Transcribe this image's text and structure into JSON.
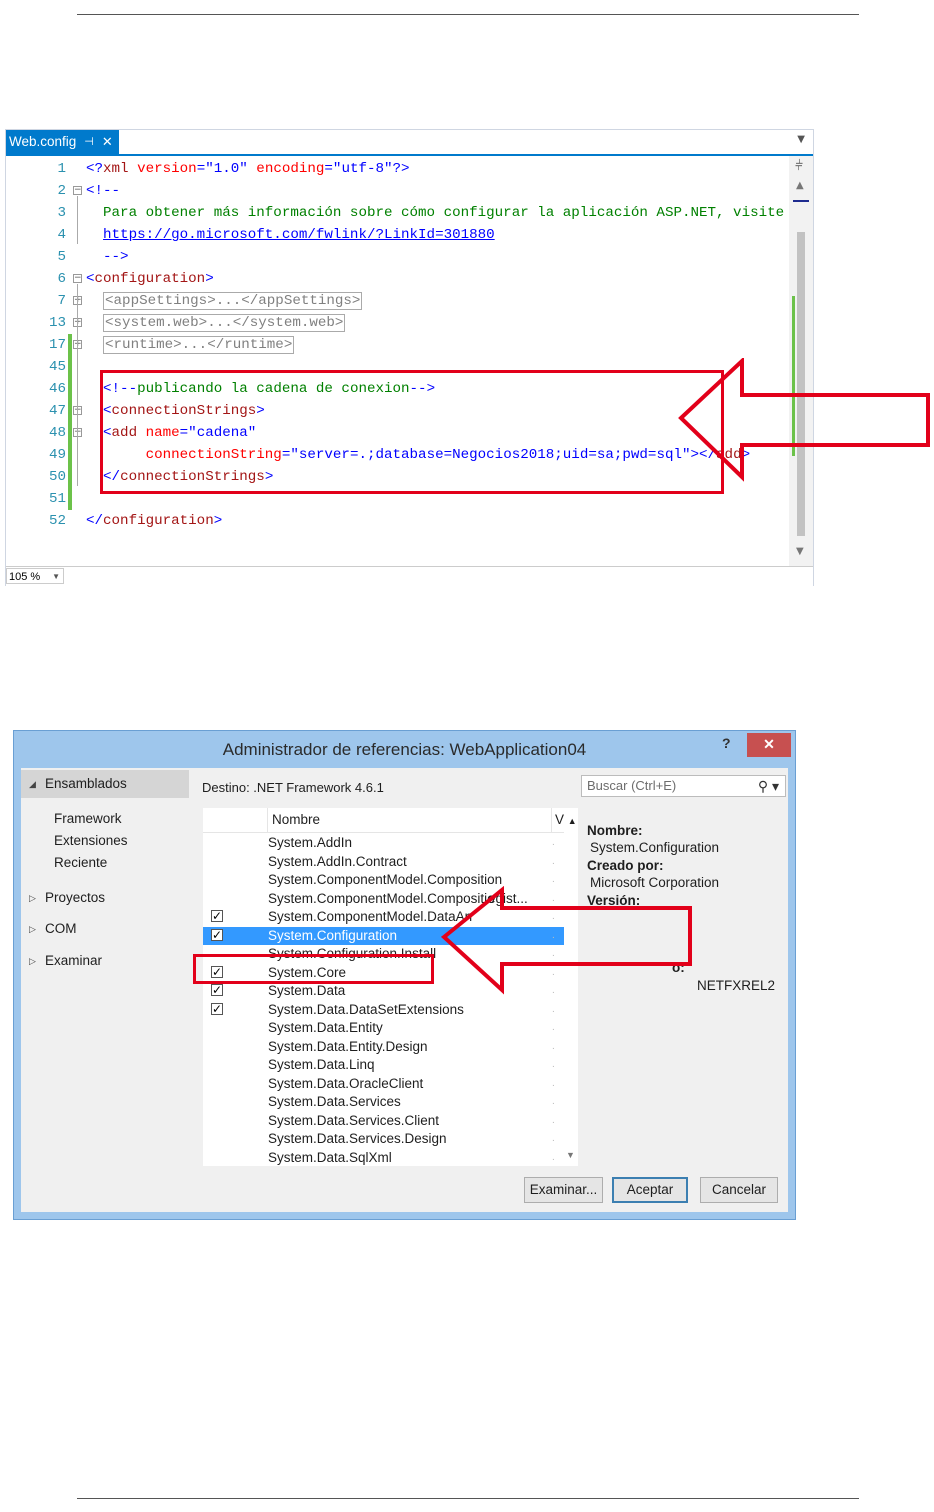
{
  "editor": {
    "tab_label": "Web.config",
    "tab_pin": "⊣",
    "tab_close": "✕",
    "zoom": "105 %",
    "lines": [
      {
        "num": "1",
        "parts": [
          [
            "blue",
            "<?"
          ],
          [
            "mar",
            "xml"
          ],
          [
            "red",
            " version"
          ],
          [
            "blue",
            "=\""
          ],
          [
            "blue",
            "1.0"
          ],
          [
            "blue",
            "\""
          ],
          [
            "red",
            " encoding"
          ],
          [
            "blue",
            "=\""
          ],
          [
            "blue",
            "utf-8"
          ],
          [
            "blue",
            "\"?>"
          ]
        ]
      },
      {
        "num": "2",
        "parts": [
          [
            "blue",
            "<!--"
          ]
        ]
      },
      {
        "num": "3",
        "parts": [
          [
            "green",
            "  Para obtener más información sobre cómo configurar la aplicación ASP.NET, visite"
          ]
        ]
      },
      {
        "num": "4",
        "parts": [
          [
            "green",
            "  "
          ],
          [
            "link",
            "https://go.microsoft.com/fwlink/?LinkId=301880"
          ]
        ]
      },
      {
        "num": "5",
        "parts": [
          [
            "blue",
            "  -->"
          ]
        ]
      },
      {
        "num": "6",
        "parts": [
          [
            "blue",
            "<"
          ],
          [
            "mar",
            "configuration"
          ],
          [
            "blue",
            ">"
          ]
        ]
      },
      {
        "num": "7",
        "parts": [
          [
            "plain",
            "  "
          ],
          [
            "collapsed",
            "<appSettings>...</appSettings>"
          ]
        ]
      },
      {
        "num": "13",
        "parts": [
          [
            "plain",
            "  "
          ],
          [
            "collapsed",
            "<system.web>...</system.web>"
          ]
        ]
      },
      {
        "num": "17",
        "parts": [
          [
            "plain",
            "  "
          ],
          [
            "collapsed",
            "<runtime>...</runtime>"
          ]
        ]
      },
      {
        "num": "45",
        "parts": []
      },
      {
        "num": "46",
        "parts": [
          [
            "blue",
            "  <!--"
          ],
          [
            "green",
            "publicando la cadena de conexion"
          ],
          [
            "blue",
            "-->"
          ]
        ]
      },
      {
        "num": "47",
        "parts": [
          [
            "blue",
            "  <"
          ],
          [
            "mar",
            "connectionStrings"
          ],
          [
            "blue",
            ">"
          ]
        ]
      },
      {
        "num": "48",
        "parts": [
          [
            "blue",
            "  <"
          ],
          [
            "mar",
            "add"
          ],
          [
            "red",
            " name"
          ],
          [
            "blue",
            "=\""
          ],
          [
            "blue",
            "cadena"
          ],
          [
            "blue",
            "\""
          ]
        ]
      },
      {
        "num": "49",
        "parts": [
          [
            "red",
            "       connectionString"
          ],
          [
            "blue",
            "=\""
          ],
          [
            "blue",
            "server=.;database=Negocios2018;uid=sa;pwd=sql"
          ],
          [
            "blue",
            "\"></"
          ],
          [
            "mar",
            "add"
          ],
          [
            "blue",
            ">"
          ]
        ]
      },
      {
        "num": "50",
        "parts": [
          [
            "blue",
            "  </"
          ],
          [
            "mar",
            "connectionStrings"
          ],
          [
            "blue",
            ">"
          ]
        ]
      },
      {
        "num": "51",
        "parts": []
      },
      {
        "num": "52",
        "parts": [
          [
            "blue",
            "</"
          ],
          [
            "mar",
            "configuration"
          ],
          [
            "blue",
            ">"
          ]
        ]
      }
    ]
  },
  "dialog": {
    "title": "Administrador de referencias: WebApplication04",
    "help": "?",
    "close": "✕",
    "nav": {
      "ensamblados": "Ensamblados",
      "framework": "Framework",
      "extensiones": "Extensiones",
      "reciente": "Reciente",
      "proyectos": "Proyectos",
      "com": "COM",
      "examinar": "Examinar"
    },
    "destino": "Destino: .NET Framework 4.6.1",
    "search_placeholder": "Buscar (Ctrl+E)",
    "columns": {
      "nombre": "Nombre",
      "version": "V"
    },
    "assemblies": [
      {
        "name": "System.AddIn",
        "checked": false
      },
      {
        "name": "System.AddIn.Contract",
        "checked": false
      },
      {
        "name": "System.ComponentModel.Composition",
        "checked": false
      },
      {
        "name": "System.ComponentModel.Compositio",
        "checked": false
      },
      {
        "name": "System.ComponentModel.DataAn",
        "checked": true
      },
      {
        "name": "System.Configuration",
        "checked": true,
        "selected": true
      },
      {
        "name": "System.Configuration.Install",
        "checked": false
      },
      {
        "name": "System.Core",
        "checked": true
      },
      {
        "name": "System.Data",
        "checked": true
      },
      {
        "name": "System.Data.DataSetExtensions",
        "checked": true
      },
      {
        "name": "System.Data.Entity",
        "checked": false
      },
      {
        "name": "System.Data.Entity.Design",
        "checked": false
      },
      {
        "name": "System.Data.Linq",
        "checked": false
      },
      {
        "name": "System.Data.OracleClient",
        "checked": false
      },
      {
        "name": "System.Data.Services",
        "checked": false
      },
      {
        "name": "System.Data.Services.Client",
        "checked": false
      },
      {
        "name": "System.Data.Services.Design",
        "checked": false
      },
      {
        "name": "System.Data.SqlXml",
        "checked": false
      }
    ],
    "row4_suffix": "egist...",
    "details": {
      "nombre_label": "Nombre:",
      "nombre_value": "System.Configuration",
      "creado_label": "Creado por:",
      "creado_value": "Microsoft Corporation",
      "version_label": "Versión:",
      "truncated": "o:",
      "netfx": "NETFXREL2"
    },
    "buttons": {
      "examinar": "Examinar...",
      "aceptar": "Aceptar",
      "cancelar": "Cancelar"
    }
  },
  "colors": {
    "accent": "#007acc",
    "highlight": "#e2001a",
    "selection": "#3399ff"
  }
}
